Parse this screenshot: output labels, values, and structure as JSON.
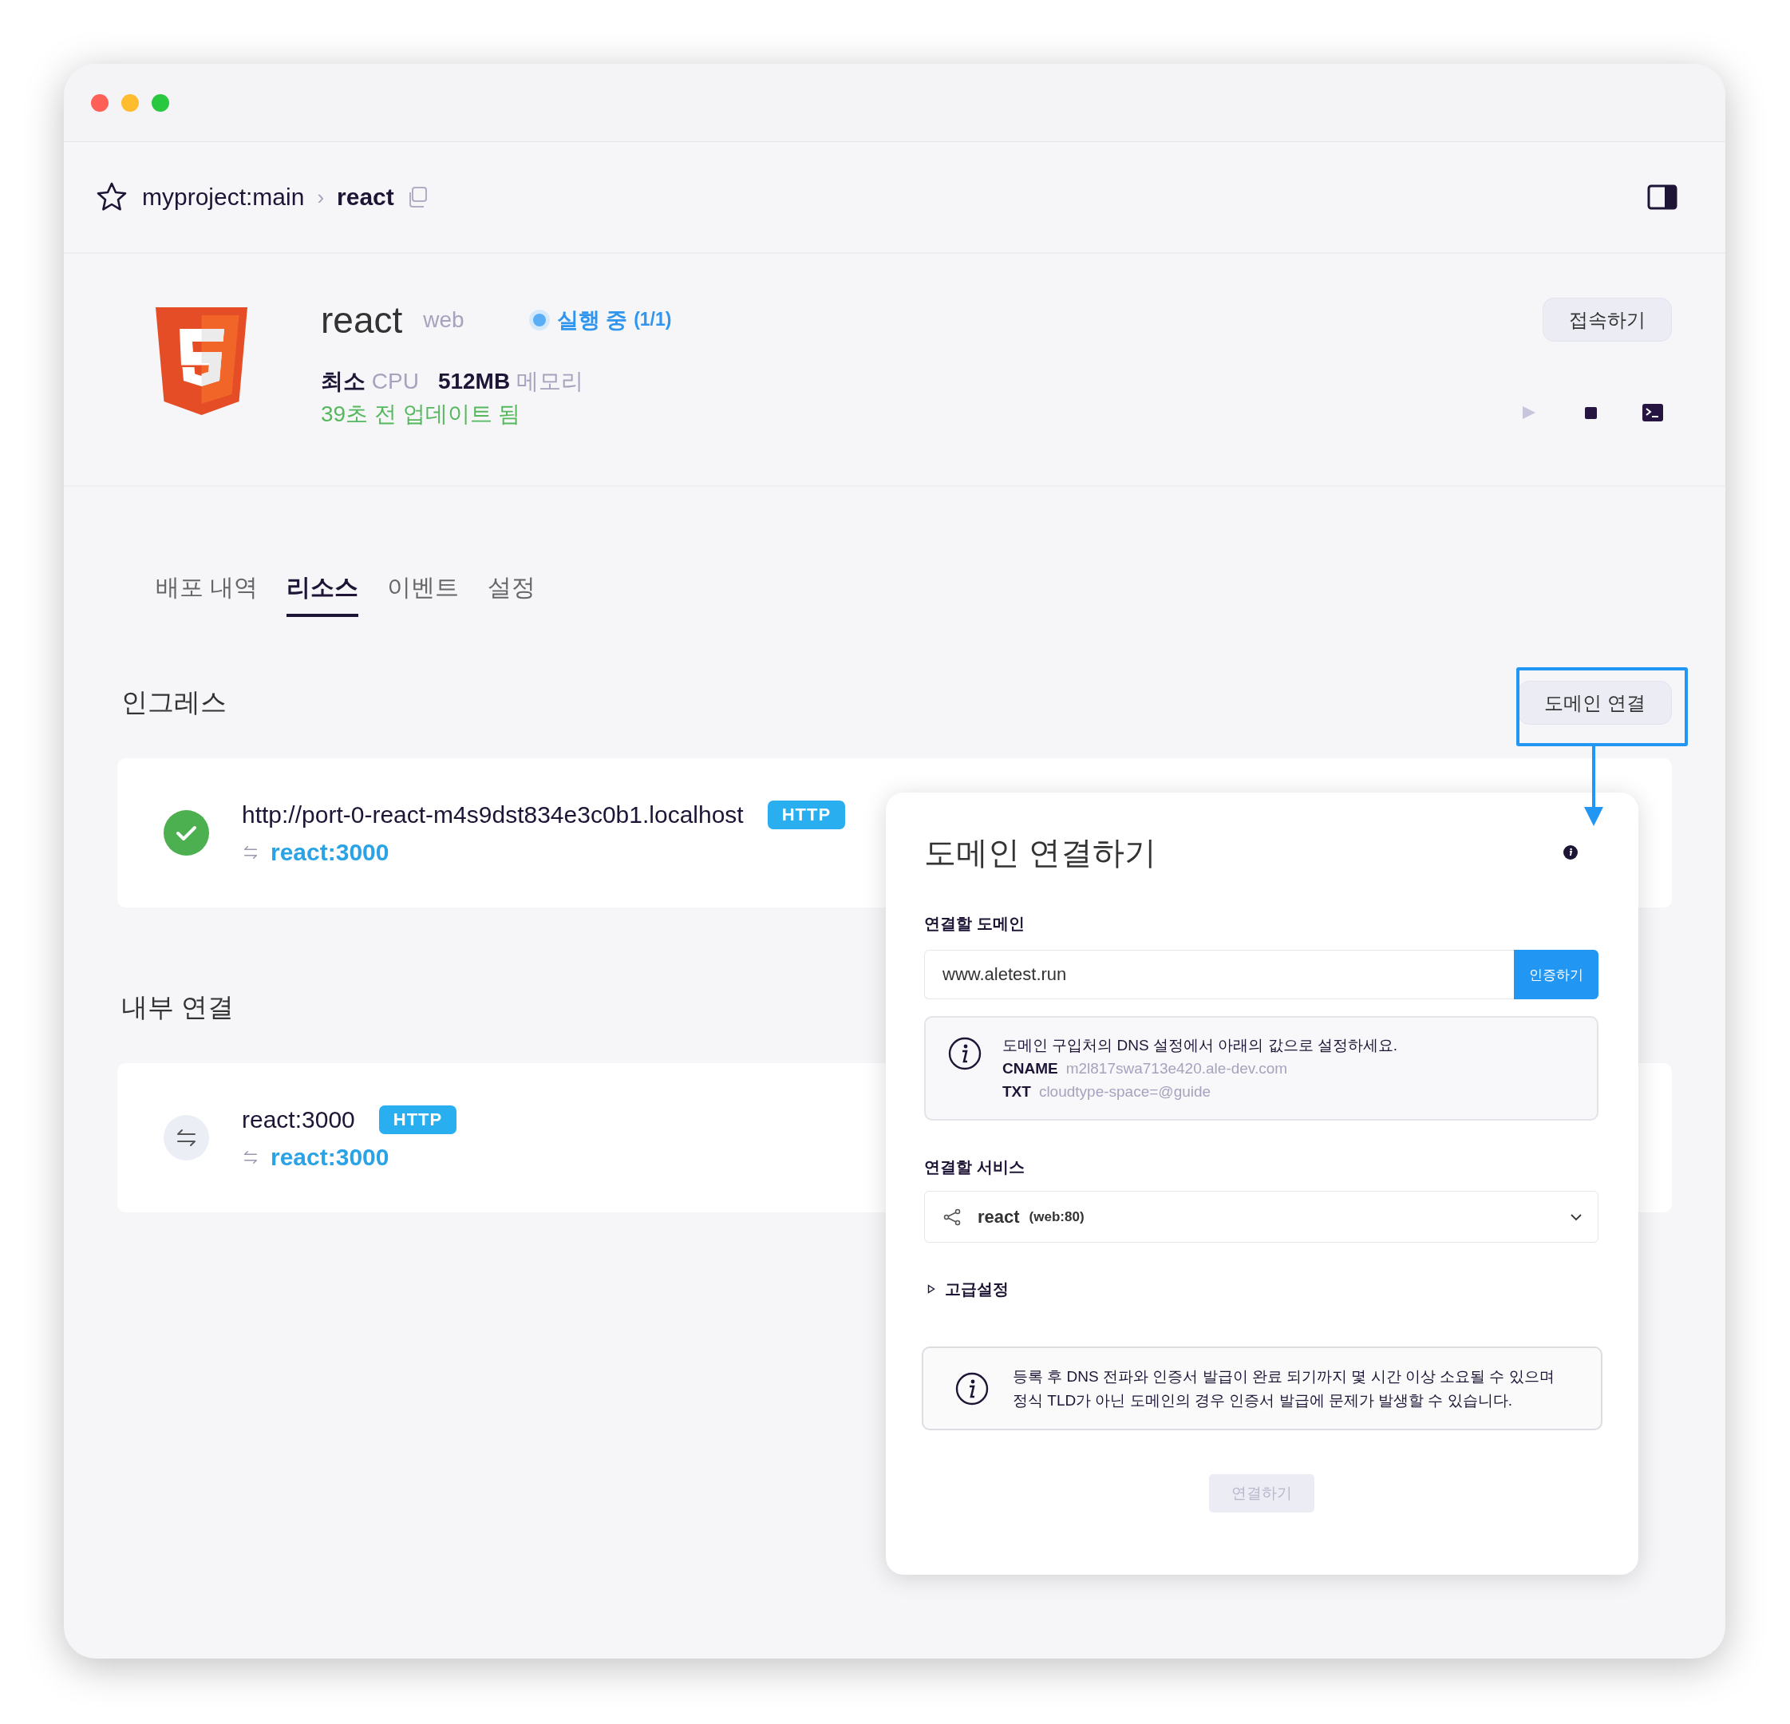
{
  "breadcrumb": {
    "project": "myproject:main",
    "separator": "›",
    "service": "react"
  },
  "service": {
    "name": "react",
    "type": "web",
    "status": {
      "label": "실행 중",
      "count": "(1/1)",
      "running": true
    },
    "specs": [
      {
        "value": "최소",
        "unit": "CPU"
      },
      {
        "value": "512MB",
        "unit": "메모리"
      }
    ],
    "updated": "39초 전 업데이트 됨",
    "connect_button": "접속하기",
    "controls": [
      {
        "kind": "play",
        "disabled": true
      },
      {
        "kind": "stop",
        "disabled": false
      },
      {
        "kind": "terminal",
        "disabled": false
      }
    ]
  },
  "tabs": [
    {
      "label": "배포 내역",
      "selected": false
    },
    {
      "label": "리소스",
      "selected": true
    },
    {
      "label": "이벤트",
      "selected": false
    },
    {
      "label": "설정",
      "selected": false
    }
  ],
  "sections": [
    {
      "title": "인그레스",
      "action": "도메인 연결",
      "action_highlighted": true,
      "items": [
        {
          "kind": "ingress",
          "address": "http://port-0-react-m4s9dst834e3c0b1.localhost",
          "protocol": "HTTP",
          "target": "react:3000"
        }
      ]
    },
    {
      "title": "내부 연결",
      "items": [
        {
          "kind": "internal",
          "address": "react:3000",
          "protocol": "HTTP",
          "target": "react:3000"
        }
      ]
    }
  ],
  "dialog": {
    "title": "도메인 연결하기",
    "domain": {
      "label": "연결할 도메인",
      "value": "www.aletest.run",
      "button": "인증하기"
    },
    "dns_hint": {
      "text": "도메인 구입처의 DNS 설정에서 아래의 값으로 설정하세요.",
      "records": [
        {
          "type": "CNAME",
          "value": "m2l817swa713e420.ale-dev.com"
        },
        {
          "type": "TXT",
          "value": "cloudtype-space=@guide"
        }
      ]
    },
    "service": {
      "label": "연결할 서비스",
      "value": "react",
      "detail": "(web:80)"
    },
    "advanced": {
      "label": "고급설정",
      "expanded": false
    },
    "notice": "등록 후 DNS 전파와 인증서 발급이 완료 되기까지 몇 시간 이상 소요될 수 있으며 정식 TLD가 아닌 도메인의 경우 인증서 발급에 문제가 발생할 수 있습니다.",
    "submit": {
      "label": "연결하기",
      "disabled": true
    }
  }
}
